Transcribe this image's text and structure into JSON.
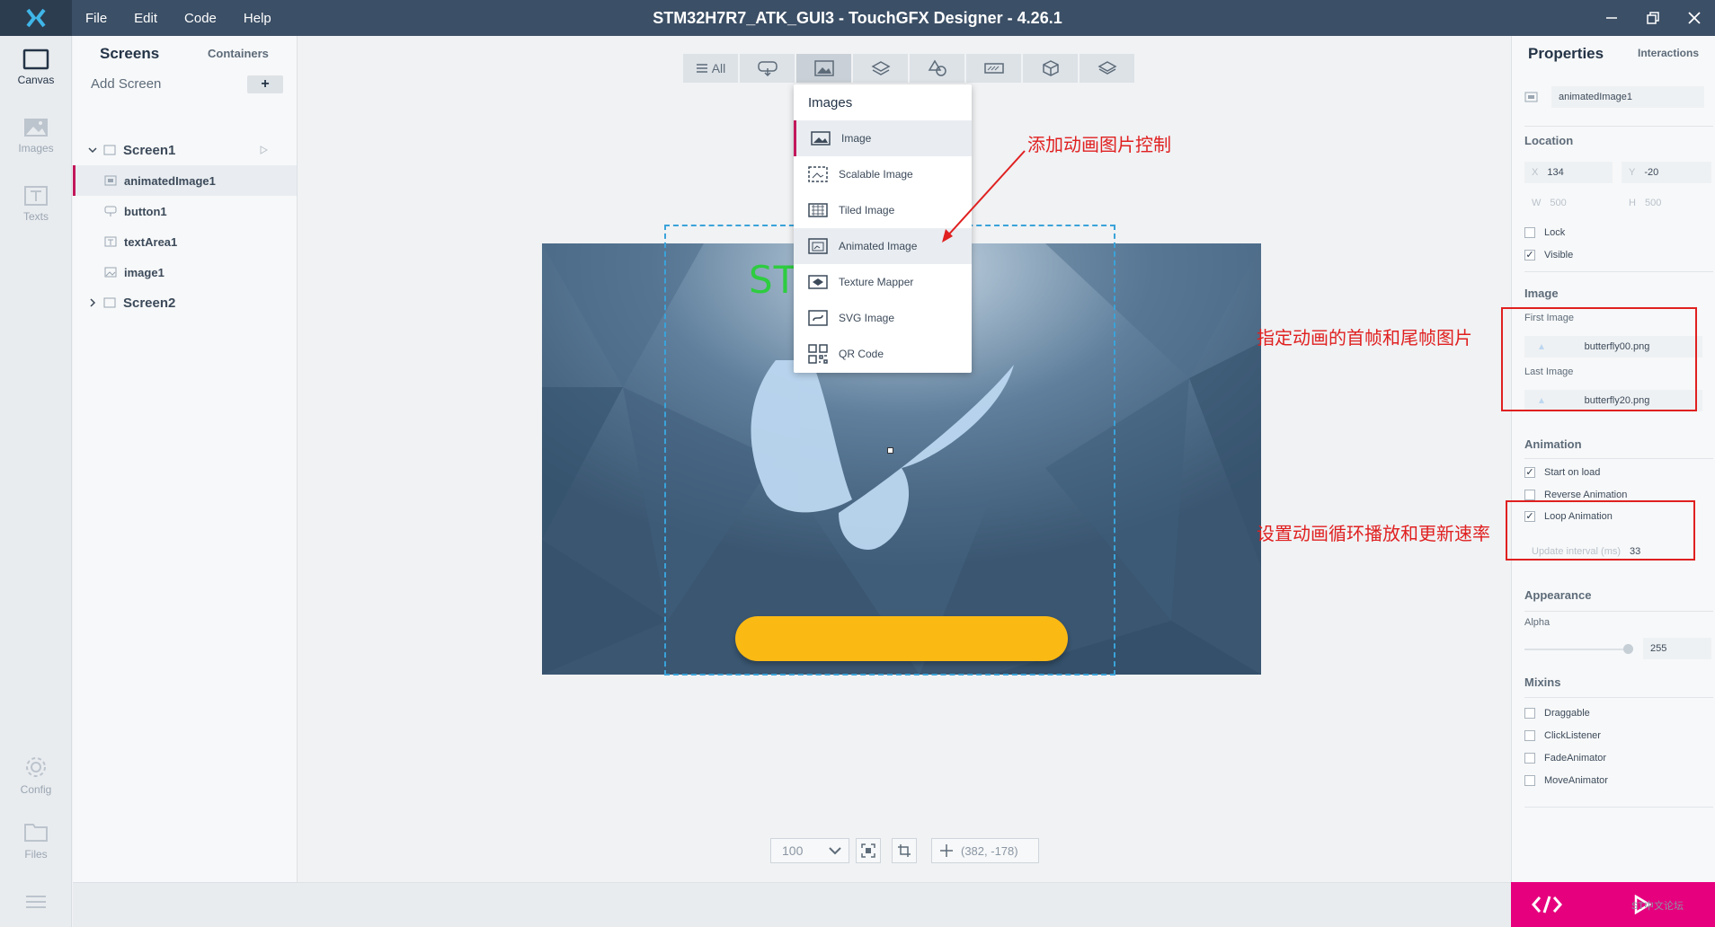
{
  "titlebar": {
    "menu": [
      "File",
      "Edit",
      "Code",
      "Help"
    ],
    "title": "STM32H7R7_ATK_GUI3 - TouchGFX Designer - 4.26.1"
  },
  "leftnav": {
    "canvas": "Canvas",
    "images": "Images",
    "texts": "Texts",
    "config": "Config",
    "files": "Files"
  },
  "screens_panel": {
    "tab_screens": "Screens",
    "tab_containers": "Containers",
    "add_screen": "Add Screen",
    "add_button": "+",
    "screen1": "Screen1",
    "children": [
      "animatedImage1",
      "button1",
      "textArea1",
      "image1"
    ],
    "screen2": "Screen2"
  },
  "toolbar": {
    "all_label": "All"
  },
  "dropdown": {
    "title": "Images",
    "items": [
      "Image",
      "Scalable Image",
      "Tiled Image",
      "Animated Image",
      "Texture Mapper",
      "SVG Image",
      "QR Code"
    ]
  },
  "canvas": {
    "text_visible": "ST                    026",
    "text_color": "#2ecc40",
    "button_color": "#fbb914",
    "zoom": "100",
    "coords": "(382, -178)"
  },
  "properties": {
    "title": "Properties",
    "interactions": "Interactions",
    "widget_name": "animatedImage1",
    "location_section": "Location",
    "x_label": "X",
    "x_value": "134",
    "y_label": "Y",
    "y_value": "-20",
    "w_label": "W",
    "w_value": "500",
    "h_label": "H",
    "h_value": "500",
    "lock": "Lock",
    "visible": "Visible",
    "image_section": "Image",
    "first_image_label": "First Image",
    "first_image": "butterfly00.png",
    "last_image_label": "Last Image",
    "last_image": "butterfly20.png",
    "animation_section": "Animation",
    "start_on_load": "Start on load",
    "reverse_animation": "Reverse Animation",
    "loop_animation": "Loop Animation",
    "update_interval_label": "Update interval (ms)",
    "update_interval": "33",
    "appearance_section": "Appearance",
    "alpha_label": "Alpha",
    "alpha_value": "255",
    "mixins_section": "Mixins",
    "mixins": [
      "Draggable",
      "ClickListener",
      "FadeAnimator",
      "MoveAnimator"
    ]
  },
  "annotations": {
    "add_animated": "添加动画图片控制",
    "first_last": "指定动画的首帧和尾帧图片",
    "loop_rate": "设置动画循环播放和更新速率",
    "color": "#e02020"
  },
  "watermark": "ST中文论坛"
}
